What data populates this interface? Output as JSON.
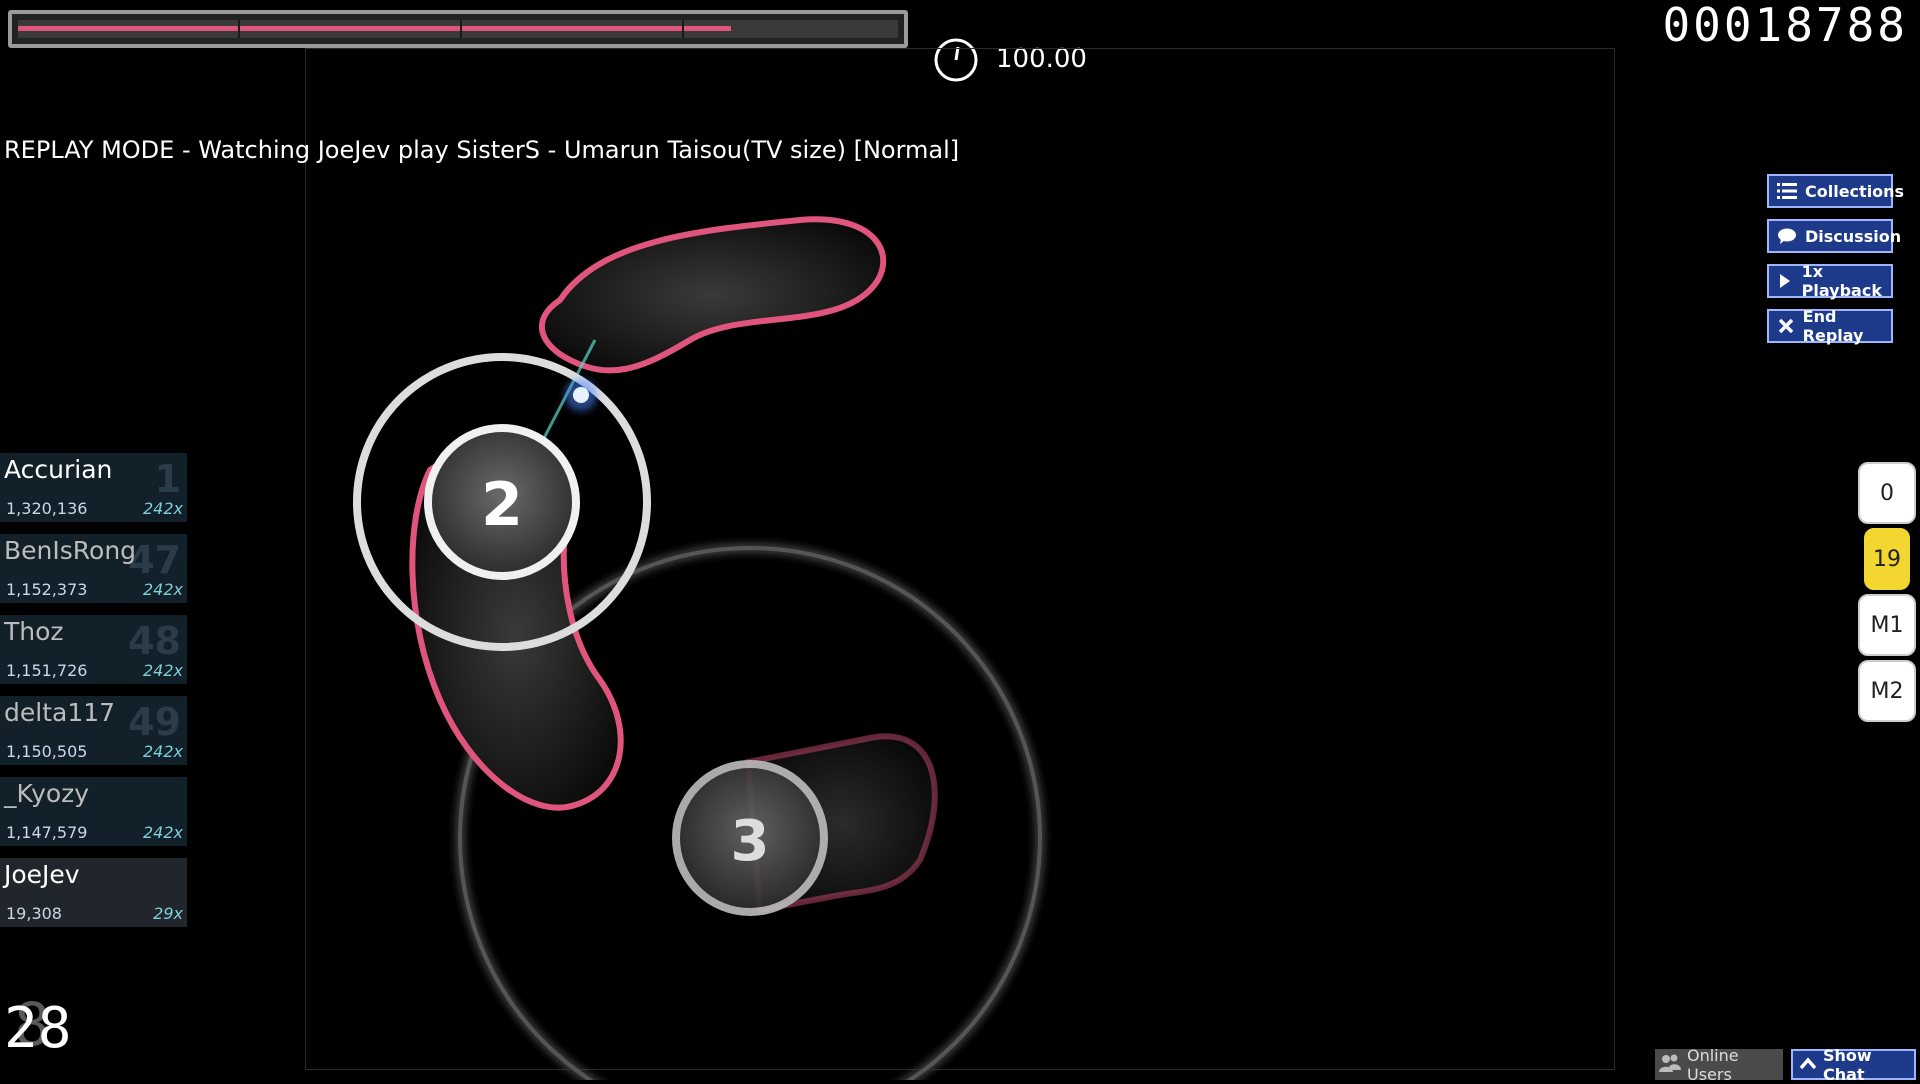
{
  "hud": {
    "score": "00018788",
    "accuracy": "100.00",
    "health_fraction": 0.81,
    "combo": "28",
    "combo_ghost": "8"
  },
  "banner": {
    "text": "REPLAY MODE - Watching JoeJev play SisterS - Umarun Taisou(TV size) [Normal]"
  },
  "side_buttons": [
    {
      "label": "Collections",
      "icon": "list-icon"
    },
    {
      "label": "Discussion",
      "icon": "chat-bubble-icon"
    },
    {
      "label": "1x Playback",
      "icon": "play-icon"
    },
    {
      "label": "End Replay",
      "icon": "close-icon"
    }
  ],
  "keys": [
    {
      "label": "0",
      "active": false
    },
    {
      "label": "19",
      "active": true
    },
    {
      "label": "M1",
      "active": false
    },
    {
      "label": "M2",
      "active": false
    }
  ],
  "leaderboard": [
    {
      "name": "Accurian",
      "score": "1,320,136",
      "combo": "242x",
      "rank": "1"
    },
    {
      "name": "BenIsRong",
      "score": "1,152,373",
      "combo": "242x",
      "rank": "47"
    },
    {
      "name": "Thoz",
      "score": "1,151,726",
      "combo": "242x",
      "rank": "48"
    },
    {
      "name": "delta117",
      "score": "1,150,505",
      "combo": "242x",
      "rank": "49"
    },
    {
      "name": "_Kyozy",
      "score": "1,147,579",
      "combo": "242x",
      "rank": ""
    },
    {
      "name": "JoeJev",
      "score": "19,308",
      "combo": "29x",
      "rank": ""
    }
  ],
  "hit_objects": [
    {
      "number": "2"
    },
    {
      "number": "3"
    }
  ],
  "footer": {
    "online_users": "Online Users",
    "show_chat": "Show Chat"
  },
  "colors": {
    "slider_border": "#e0557e",
    "button_bg": "#1e3a8a",
    "key_active": "#f4d631"
  }
}
